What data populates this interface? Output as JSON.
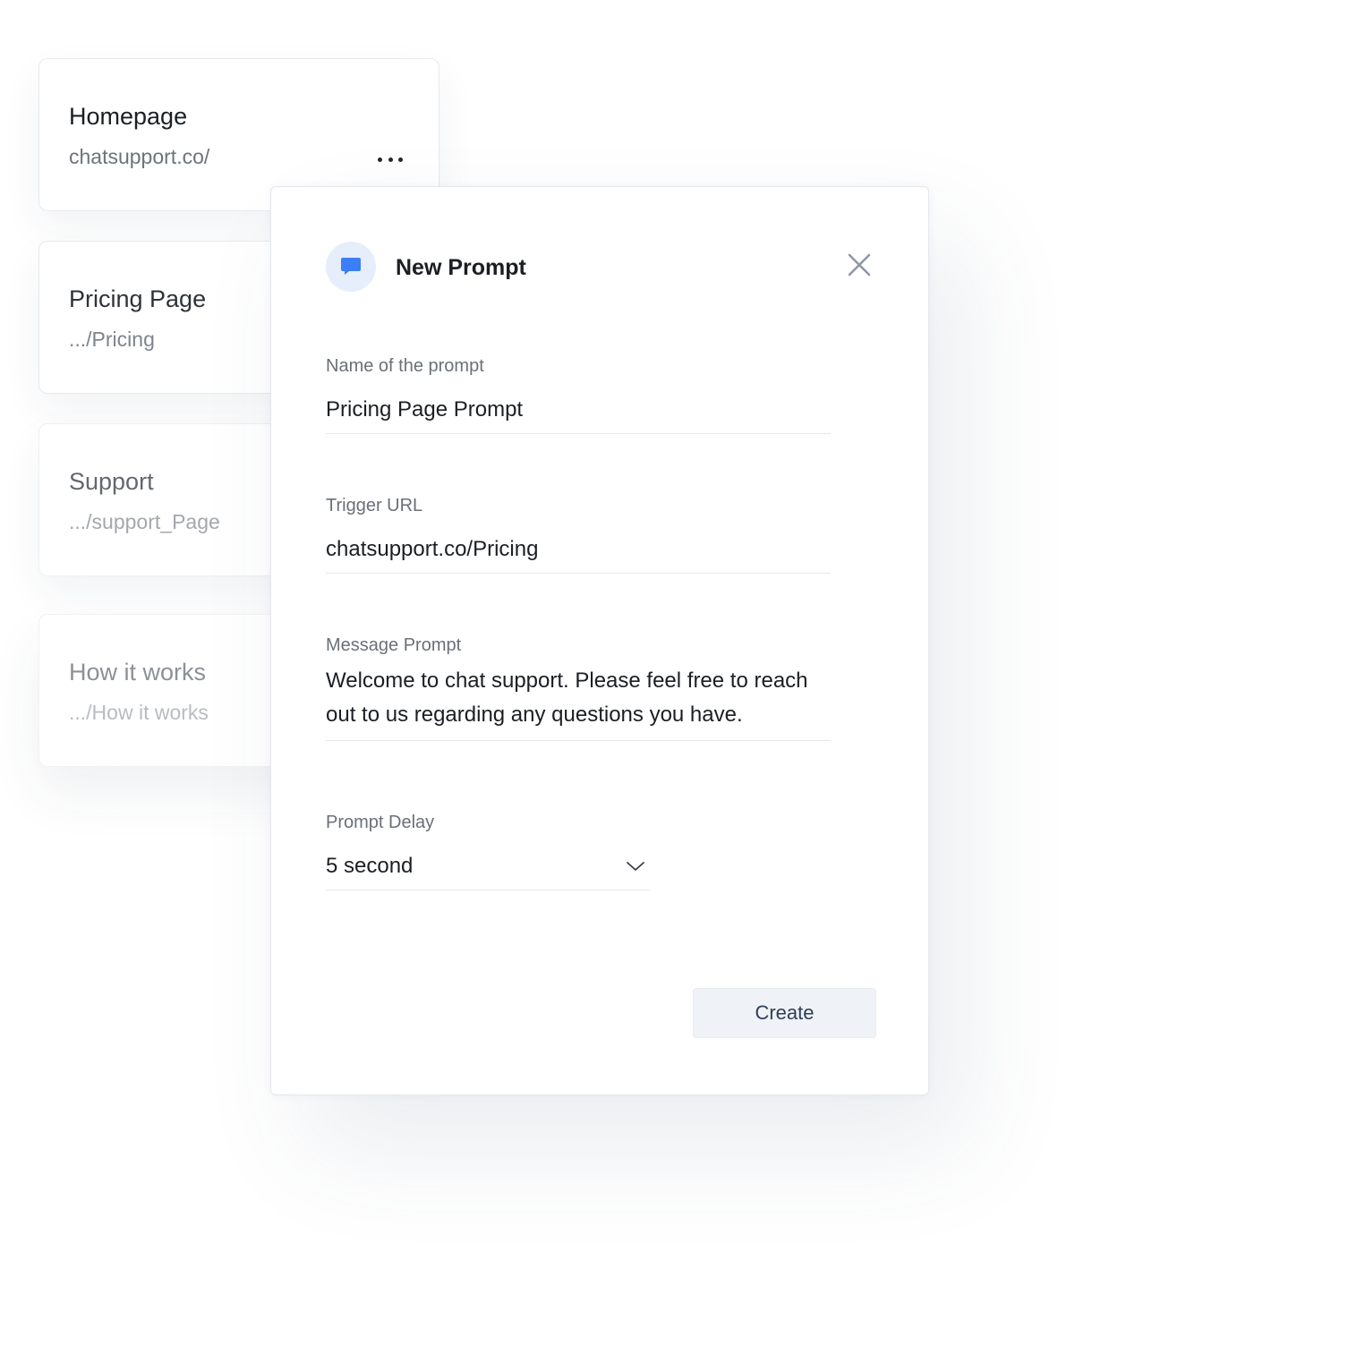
{
  "pages": [
    {
      "title": "Homepage",
      "url": "chatsupport.co/"
    },
    {
      "title": "Pricing Page",
      "url": ".../Pricing"
    },
    {
      "title": "Support",
      "url": ".../support_Page"
    },
    {
      "title": "How it works",
      "url": ".../How it works"
    }
  ],
  "icons": {
    "more": "more-horizontal-icon",
    "modal": "chat-bubble-icon",
    "close": "close-icon",
    "select": "chevron-down-icon"
  },
  "colors": {
    "accent": "#3b7ef5",
    "icon_bg": "#e6eefb",
    "button_bg": "#eff2f6",
    "button_text": "#2d3f58"
  },
  "modal": {
    "title": "New Prompt",
    "fields": {
      "name": {
        "label": "Name of the prompt",
        "value": "Pricing Page Prompt"
      },
      "trigger_url": {
        "label": "Trigger URL",
        "value": "chatsupport.co/Pricing"
      },
      "message": {
        "label": "Message Prompt",
        "value": "Welcome to chat support. Please feel free to reach out to us regarding any questions you have."
      },
      "delay": {
        "label": "Prompt Delay",
        "value": "5 second"
      }
    },
    "create_label": "Create"
  }
}
